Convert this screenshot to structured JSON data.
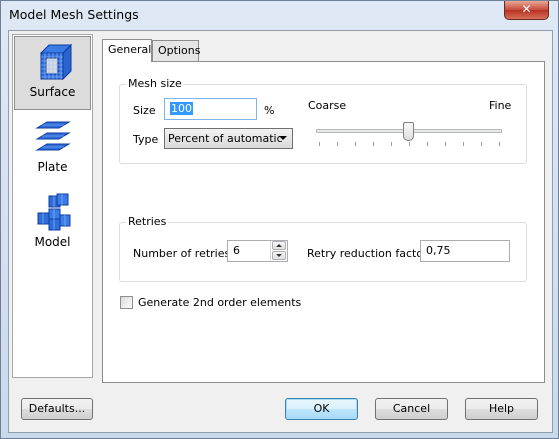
{
  "window": {
    "title": "Model Mesh Settings",
    "close_glyph": "✕"
  },
  "shortcuts": [
    {
      "label": "Surface",
      "icon": "surface-icon",
      "active": true
    },
    {
      "label": "Plate",
      "icon": "plate-icon",
      "active": false
    },
    {
      "label": "Model",
      "icon": "model-icon",
      "active": false
    }
  ],
  "tabs": [
    {
      "label": "General",
      "active": true
    },
    {
      "label": "Options",
      "active": false
    }
  ],
  "mesh_size": {
    "group_title": "Mesh size",
    "size_label": "Size",
    "size_value": "100",
    "size_unit": "%",
    "type_label": "Type",
    "type_value": "Percent of automatic",
    "coarse_label": "Coarse",
    "fine_label": "Fine",
    "slider_level": 0.5
  },
  "retries": {
    "group_title": "Retries",
    "number_label": "Number of retries",
    "number_value": "6",
    "factor_label": "Retry reduction factor",
    "factor_value": "0,75"
  },
  "second_order": {
    "label": "Generate 2nd order elements",
    "checked": false
  },
  "buttons": {
    "defaults": "Defaults...",
    "ok": "OK",
    "cancel": "Cancel",
    "help": "Help"
  },
  "colors": {
    "icon_blue": "#1f5fd1",
    "accent": "#3399ff"
  }
}
